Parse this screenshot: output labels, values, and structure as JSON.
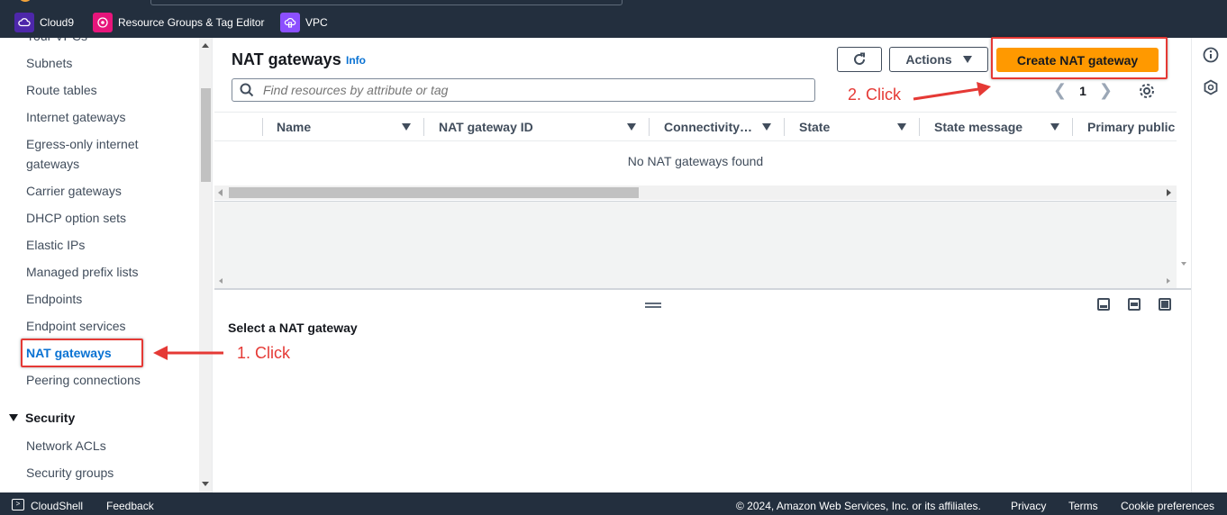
{
  "favorites": [
    {
      "label": "Cloud9",
      "color": "#4d27aa",
      "icon": "cloud9-icon"
    },
    {
      "label": "Resource Groups & Tag Editor",
      "color": "#e7157b",
      "icon": "resource-groups-icon"
    },
    {
      "label": "VPC",
      "color": "#8c4fff",
      "icon": "vpc-icon"
    }
  ],
  "sidebar": {
    "items": [
      {
        "label": "Your VPCs"
      },
      {
        "label": "Subnets"
      },
      {
        "label": "Route tables"
      },
      {
        "label": "Internet gateways"
      },
      {
        "label": "Egress-only internet"
      },
      {
        "label": "gateways"
      },
      {
        "label": "Carrier gateways"
      },
      {
        "label": "DHCP option sets"
      },
      {
        "label": "Elastic IPs"
      },
      {
        "label": "Managed prefix lists"
      },
      {
        "label": "Endpoints"
      },
      {
        "label": "Endpoint services"
      },
      {
        "label": "NAT gateways",
        "active": true
      },
      {
        "label": "Peering connections"
      }
    ],
    "security_section": "Security",
    "security_items": [
      {
        "label": "Network ACLs"
      },
      {
        "label": "Security groups"
      }
    ]
  },
  "main": {
    "title": "NAT gateways",
    "info": "Info",
    "actions_label": "Actions",
    "create_label": "Create NAT gateway",
    "search_placeholder": "Find resources by attribute or tag",
    "page": "1",
    "columns": [
      "Name",
      "NAT gateway ID",
      "Connectivity…",
      "State",
      "State message",
      "Primary public"
    ],
    "empty_message": "No NAT gateways found",
    "detail_title": "Select a NAT gateway"
  },
  "footer": {
    "cloudshell": "CloudShell",
    "feedback": "Feedback",
    "copyright": "© 2024, Amazon Web Services, Inc. or its affiliates.",
    "privacy": "Privacy",
    "terms": "Terms",
    "cookies": "Cookie preferences"
  },
  "annotations": {
    "step1": "1. Click",
    "step2": "2. Click",
    "color": "#e53935"
  },
  "colors": {
    "nav_bg": "#232f3e",
    "primary_button": "#ff9900",
    "link": "#0972d3"
  }
}
